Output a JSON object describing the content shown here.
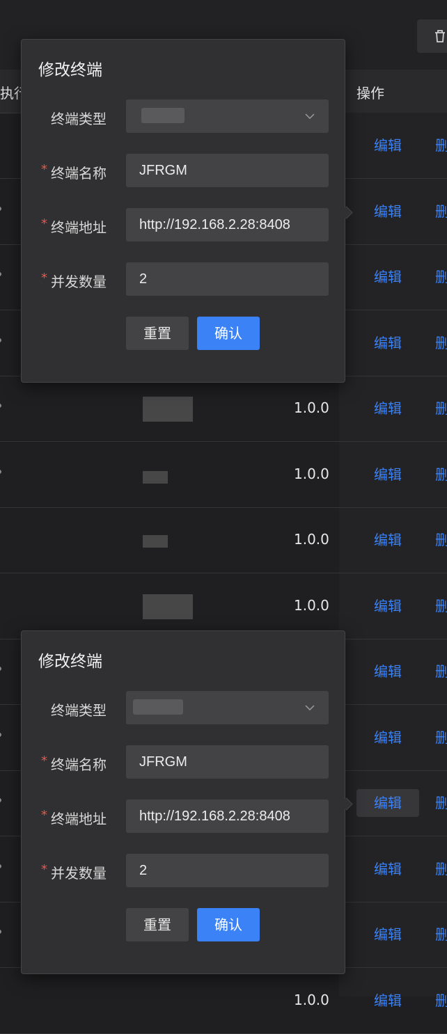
{
  "header": {
    "col_exec": "执行",
    "col_op": "操作",
    "trash_icon": "trash-icon"
  },
  "rows": [
    {
      "version": "",
      "edit": "编辑",
      "del": "删"
    },
    {
      "version": "",
      "edit": "编辑",
      "del": "删"
    },
    {
      "version": "",
      "edit": "编辑",
      "del": "删"
    },
    {
      "version": "",
      "edit": "编辑",
      "del": "删"
    },
    {
      "version": "1.0.0",
      "edit": "编辑",
      "del": "删"
    },
    {
      "version": "1.0.0",
      "edit": "编辑",
      "del": "删"
    },
    {
      "version": "1.0.0",
      "edit": "编辑",
      "del": "删"
    },
    {
      "version": "1.0.0",
      "edit": "编辑",
      "del": "删"
    },
    {
      "version": "",
      "edit": "编辑",
      "del": "删"
    },
    {
      "version": "",
      "edit": "编辑",
      "del": "删"
    },
    {
      "version": "",
      "edit": "编辑",
      "del": "删"
    },
    {
      "version": "",
      "edit": "编辑",
      "del": "删"
    },
    {
      "version": "",
      "edit": "编辑",
      "del": "删"
    },
    {
      "version": "1.0.0",
      "edit": "编辑",
      "del": "删"
    }
  ],
  "popovers": [
    {
      "title": "修改终端",
      "fields": {
        "type_label": "终端类型",
        "name_label": "终端名称",
        "name_value": "JFRGM",
        "address_label": "终端地址",
        "address_value": "http://192.168.2.28:8408",
        "concurrency_label": "并发数量",
        "concurrency_value": "2"
      },
      "reset_label": "重置",
      "confirm_label": "确认"
    },
    {
      "title": "修改终端",
      "fields": {
        "type_label": "终端类型",
        "name_label": "终端名称",
        "name_value": "JFRGM",
        "address_label": "终端地址",
        "address_value": "http://192.168.2.28:8408",
        "concurrency_label": "并发数量",
        "concurrency_value": "2"
      },
      "reset_label": "重置",
      "confirm_label": "确认"
    }
  ],
  "colors": {
    "accent": "#3a82f6",
    "link": "#3b82f6",
    "required": "#e8564b",
    "background": "#1f1f21",
    "popover": "#303032"
  }
}
